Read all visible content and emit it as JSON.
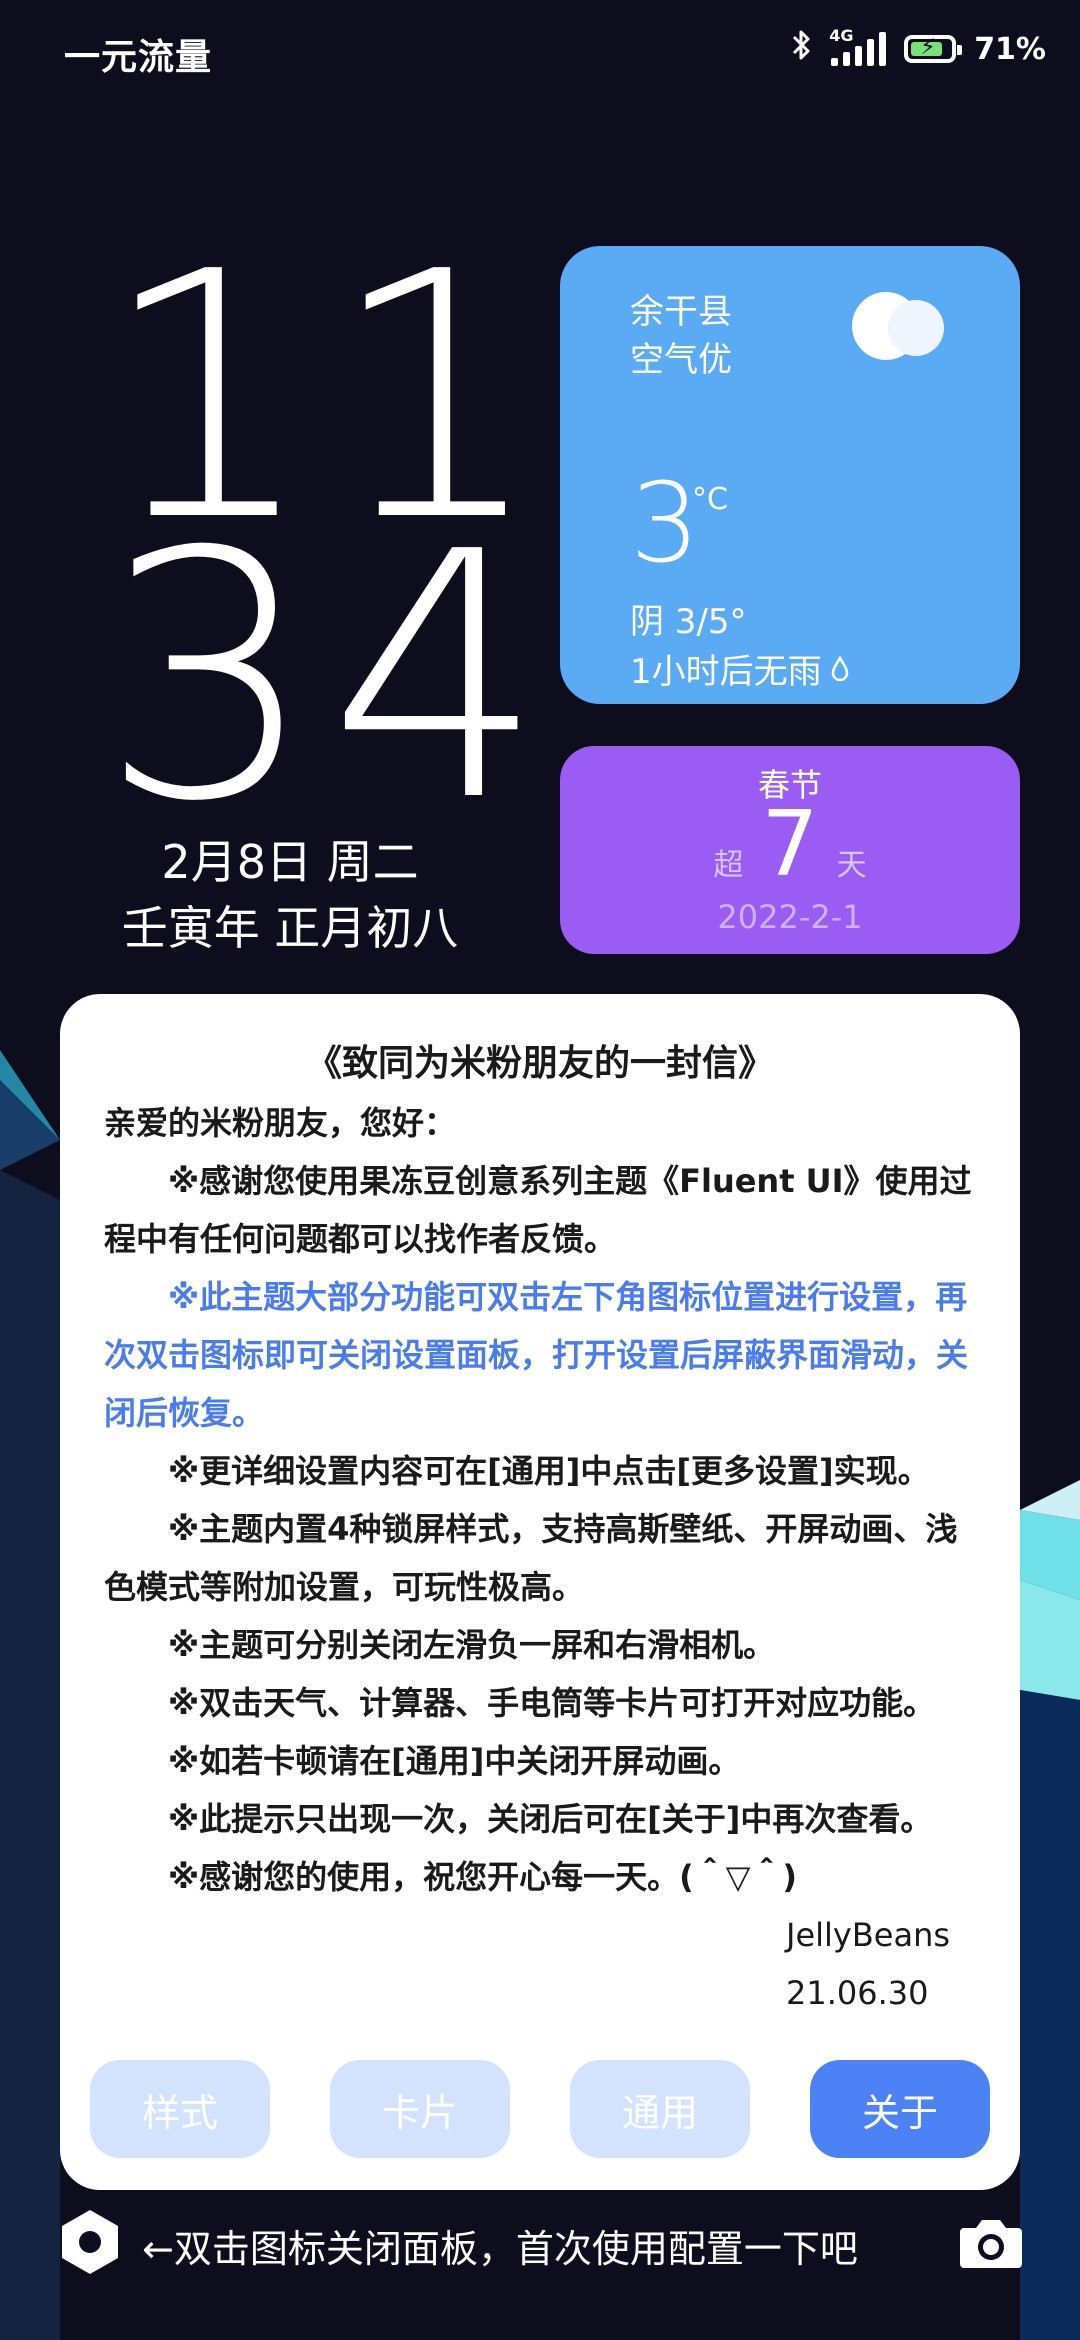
{
  "status_bar": {
    "carrier": "一元流量",
    "network": "4G",
    "battery": "71%"
  },
  "clock": {
    "hours": "11",
    "minutes": "34",
    "date": "2月8日 周二",
    "lunar": "壬寅年 正月初八"
  },
  "weather": {
    "location": "余干县",
    "air_quality": "空气优",
    "temperature": "3",
    "unit": "°C",
    "condition": "阴  3/5°",
    "forecast": "1小时后无雨"
  },
  "festival": {
    "name": "春节",
    "prefix": "超",
    "days": "7",
    "suffix": "天",
    "date": "2022-2-1"
  },
  "letter": {
    "title": "《致同为米粉朋友的一封信》",
    "greeting": "亲爱的米粉朋友，您好：",
    "p1": "※感谢您使用果冻豆创意系列主题《Fluent UI》使用过程中有任何问题都可以找作者反馈。",
    "p2": "※此主题大部分功能可双击左下角图标位置进行设置，再次双击图标即可关闭设置面板，打开设置后屏蔽界面滑动，关闭后恢复。",
    "p3": "※更详细设置内容可在[通用]中点击[更多设置]实现。",
    "p4": "※主题内置4种锁屏样式，支持高斯壁纸、开屏动画、浅色模式等附加设置，可玩性极高。",
    "p5": "※主题可分别关闭左滑负一屏和右滑相机。",
    "p6": "※双击天气、计算器、手电筒等卡片可打开对应功能。",
    "p7": "※如若卡顿请在[通用]中关闭开屏动画。",
    "p8": "※此提示只出现一次，关闭后可在[关于]中再次查看。",
    "p9": "※感谢您的使用，祝您开心每一天。(＾▽＾)",
    "author": "JellyBeans",
    "date": "21.06.30"
  },
  "panel_buttons": {
    "style": "样式",
    "card": "卡片",
    "general": "通用",
    "about": "关于"
  },
  "bottom": {
    "hint": "←双击图标关闭面板，首次使用配置一下吧"
  },
  "colors": {
    "weather_card": "#5aaaf4",
    "festival_card": "#9a5cf2",
    "accent_blue": "#4a7cf0",
    "active_button": "#4c82f5",
    "inactive_button": "#d3e3fd"
  },
  "icons": {
    "bluetooth": "bluetooth-icon",
    "signal": "signal-icon",
    "battery": "battery-icon",
    "weather": "cloud-icon",
    "rain": "raindrop-icon",
    "settings": "hexagon-settings-icon",
    "camera": "camera-icon"
  }
}
